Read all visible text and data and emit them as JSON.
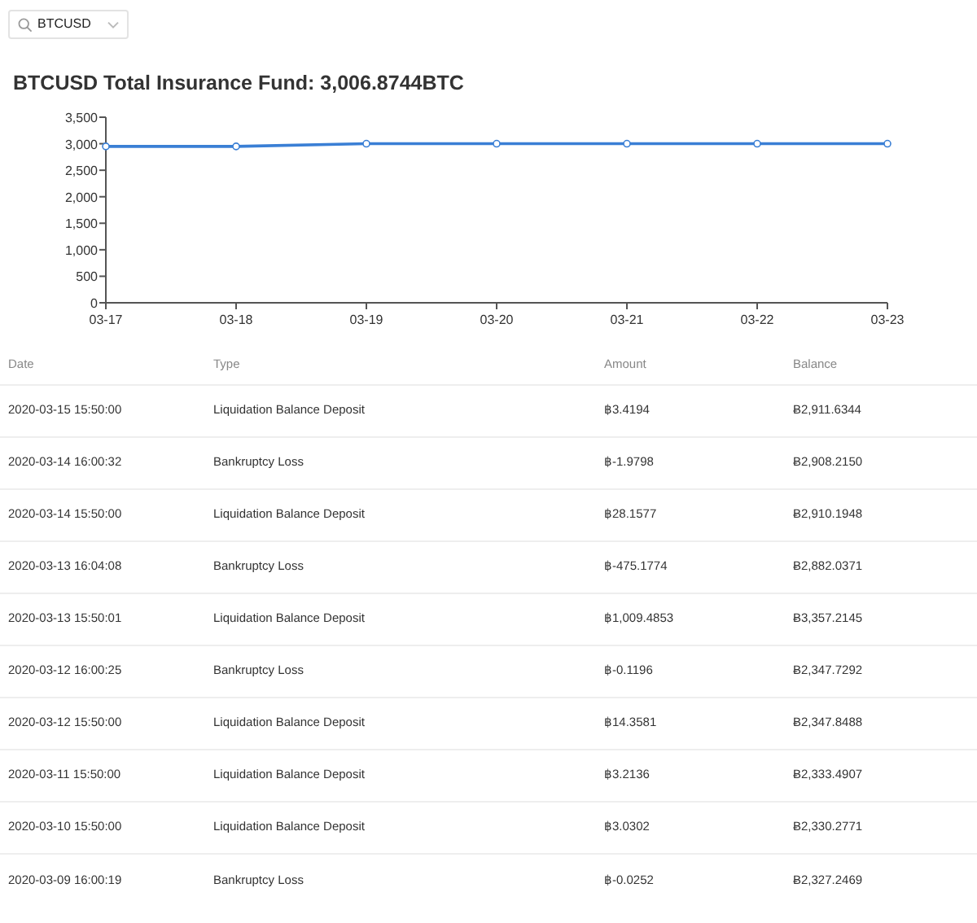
{
  "search": {
    "value": "BTCUSD"
  },
  "title": "BTCUSD Total Insurance Fund: 3,006.8744BTC",
  "chart_data": {
    "type": "line",
    "categories": [
      "03-17",
      "03-18",
      "03-19",
      "03-20",
      "03-21",
      "03-22",
      "03-23"
    ],
    "ylim": [
      0,
      3500
    ],
    "yticks": [
      {
        "value": 0,
        "label": "0"
      },
      {
        "value": 500,
        "label": "500"
      },
      {
        "value": 1000,
        "label": "1,000"
      },
      {
        "value": 1500,
        "label": "1,500"
      },
      {
        "value": 2000,
        "label": "2,000"
      },
      {
        "value": 2500,
        "label": "2,500"
      },
      {
        "value": 3000,
        "label": "3,000"
      },
      {
        "value": 3500,
        "label": "3,500"
      }
    ],
    "series": [
      {
        "color": "#3a7fd5",
        "marker": true,
        "values": [
          2950,
          2950,
          3000,
          3000,
          3000,
          3000,
          3000
        ]
      }
    ]
  },
  "table": {
    "columns": [
      "Date",
      "Type",
      "Amount",
      "Balance"
    ],
    "rows": [
      [
        "2020-03-15 15:50:00",
        "Liquidation Balance Deposit",
        "฿3.4194",
        "Ƀ2,911.6344"
      ],
      [
        "2020-03-14 16:00:32",
        "Bankruptcy Loss",
        "฿-1.9798",
        "Ƀ2,908.2150"
      ],
      [
        "2020-03-14 15:50:00",
        "Liquidation Balance Deposit",
        "฿28.1577",
        "Ƀ2,910.1948"
      ],
      [
        "2020-03-13 16:04:08",
        "Bankruptcy Loss",
        "฿-475.1774",
        "Ƀ2,882.0371"
      ],
      [
        "2020-03-13 15:50:01",
        "Liquidation Balance Deposit",
        "฿1,009.4853",
        "Ƀ3,357.2145"
      ],
      [
        "2020-03-12 16:00:25",
        "Bankruptcy Loss",
        "฿-0.1196",
        "Ƀ2,347.7292"
      ],
      [
        "2020-03-12 15:50:00",
        "Liquidation Balance Deposit",
        "฿14.3581",
        "Ƀ2,347.8488"
      ],
      [
        "2020-03-11 15:50:00",
        "Liquidation Balance Deposit",
        "฿3.2136",
        "Ƀ2,333.4907"
      ],
      [
        "2020-03-10 15:50:00",
        "Liquidation Balance Deposit",
        "฿3.0302",
        "Ƀ2,330.2771"
      ],
      [
        "2020-03-09 16:00:19",
        "Bankruptcy Loss",
        "฿-0.0252",
        "Ƀ2,327.2469"
      ]
    ]
  }
}
